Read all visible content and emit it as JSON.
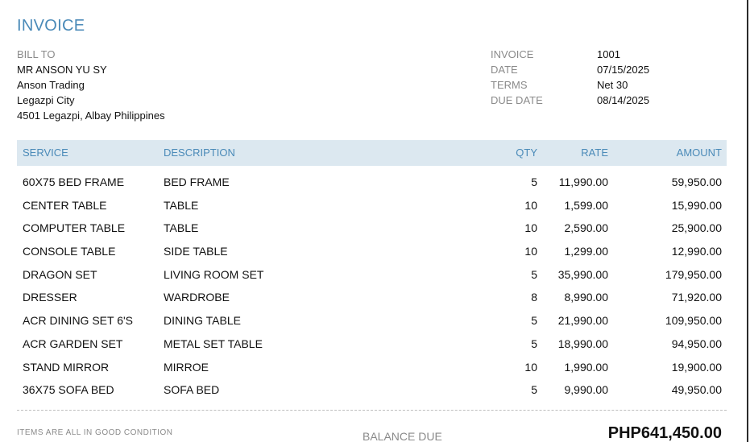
{
  "invoice_title": "INVOICE",
  "bill_to": {
    "label": "BILL TO",
    "lines": [
      "MR ANSON YU SY",
      "Anson Trading",
      "Legazpi City",
      "4501 Legazpi, Albay Philippines"
    ]
  },
  "meta": [
    {
      "label": "INVOICE",
      "value": "1001"
    },
    {
      "label": "DATE",
      "value": "07/15/2025"
    },
    {
      "label": "TERMS",
      "value": "Net 30"
    },
    {
      "label": "DUE DATE",
      "value": "08/14/2025"
    }
  ],
  "table": {
    "headers": {
      "service": "SERVICE",
      "description": "DESCRIPTION",
      "qty": "QTY",
      "rate": "RATE",
      "amount": "AMOUNT"
    },
    "rows": [
      {
        "service": "60X75 BED FRAME",
        "description": "BED FRAME",
        "qty": "5",
        "rate": "11,990.00",
        "amount": "59,950.00"
      },
      {
        "service": "CENTER TABLE",
        "description": "TABLE",
        "qty": "10",
        "rate": "1,599.00",
        "amount": "15,990.00"
      },
      {
        "service": "COMPUTER TABLE",
        "description": "TABLE",
        "qty": "10",
        "rate": "2,590.00",
        "amount": "25,900.00"
      },
      {
        "service": "CONSOLE TABLE",
        "description": "SIDE TABLE",
        "qty": "10",
        "rate": "1,299.00",
        "amount": "12,990.00"
      },
      {
        "service": "DRAGON SET",
        "description": "LIVING ROOM SET",
        "qty": "5",
        "rate": "35,990.00",
        "amount": "179,950.00"
      },
      {
        "service": "DRESSER",
        "description": "WARDROBE",
        "qty": "8",
        "rate": "8,990.00",
        "amount": "71,920.00"
      },
      {
        "service": "ACR DINING SET 6'S",
        "description": "DINING TABLE",
        "qty": "5",
        "rate": "21,990.00",
        "amount": "109,950.00"
      },
      {
        "service": "ACR GARDEN SET",
        "description": "METAL SET TABLE",
        "qty": "5",
        "rate": "18,990.00",
        "amount": "94,950.00"
      },
      {
        "service": "STAND MIRROR",
        "description": "MIRROE",
        "qty": "10",
        "rate": "1,990.00",
        "amount": "19,900.00"
      },
      {
        "service": "36X75 SOFA BED",
        "description": "SOFA BED",
        "qty": "5",
        "rate": "9,990.00",
        "amount": "49,950.00"
      }
    ]
  },
  "footer": {
    "note": "ITEMS ARE ALL IN GOOD CONDITION",
    "balance_label": "BALANCE DUE",
    "balance_value": "PHP641,450.00"
  },
  "colors": {
    "accent": "#4a8ab8",
    "header_bg": "#dce8f0",
    "muted": "#8a8a8a"
  }
}
